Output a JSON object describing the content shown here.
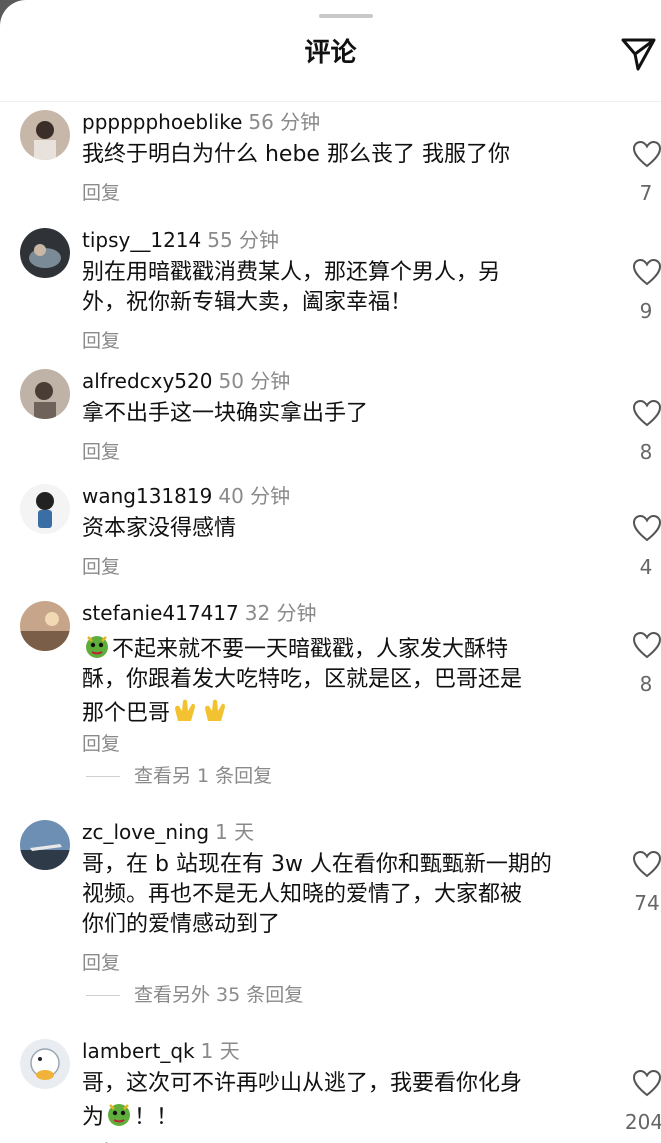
{
  "header": {
    "title": "评论",
    "send_icon": "paper-plane-icon"
  },
  "colors": {
    "background": "#ffffff",
    "secondary_text": "#8a8a8a",
    "primary_text": "#111111"
  },
  "comments": [
    {
      "username": "pppppphoeblike",
      "time": "56 分钟",
      "lines": [
        "我终于明白为什么 hebe 那么丧了 我服了你"
      ],
      "reply": "回复",
      "likes": "7"
    },
    {
      "username": "tipsy__1214",
      "time": "55 分钟",
      "lines": [
        "别在用暗戳戳消费某人，那还算个男人，另",
        "外，祝你新专辑大卖，阖家幸福！"
      ],
      "reply": "回复",
      "likes": "9"
    },
    {
      "username": "alfredcxy520",
      "time": "50 分钟",
      "lines": [
        "拿不出手这一块确实拿出手了"
      ],
      "reply": "回复",
      "likes": "8"
    },
    {
      "username": "wang131819",
      "time": "40 分钟",
      "lines": [
        "资本家没得感情"
      ],
      "reply": "回复",
      "likes": "4"
    },
    {
      "username": "stefanie417417",
      "time": "32 分钟",
      "lines": [
        "不起来就不要一天暗戳戳，人家发大酥特",
        "酥，你跟着发大吃特吃，区就是区，巴哥还是",
        "那个巴哥"
      ],
      "reply": "回复",
      "likes": "8",
      "more_replies": "查看另 1 条回复"
    },
    {
      "username": "zc_love_ning",
      "time": "1 天",
      "lines": [
        "哥，在 b 站现在有 3w 人在看你和甄甄新一期的",
        "视频。再也不是无人知晓的爱情了，大家都被",
        "你们的爱情感动到了"
      ],
      "reply": "回复",
      "likes": "74",
      "more_replies": "查看另外 35 条回复"
    },
    {
      "username": "lambert_qk",
      "time": "1 天",
      "lines": [
        "哥，这次可不许再吵山从逃了，我要看你化身",
        "为",
        "！！"
      ],
      "reply": "回复",
      "likes": "204"
    }
  ]
}
